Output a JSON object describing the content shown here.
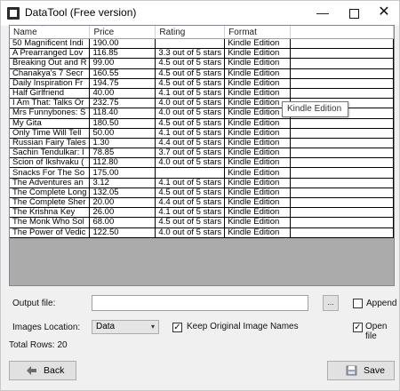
{
  "window": {
    "title": "DataTool (Free version)",
    "controls": {
      "minimize": "—",
      "close": "✕"
    }
  },
  "grid": {
    "columns": [
      "Name",
      "Price",
      "Rating",
      "Format"
    ],
    "sort_indicator": "^",
    "rows": [
      [
        "50 Magnificent Indi",
        "190.00",
        "",
        "Kindle Edition"
      ],
      [
        "A Prearranged Lov",
        "116.85",
        "3.3 out of 5 stars",
        "Kindle Edition"
      ],
      [
        "Breaking Out and R",
        "99.00",
        "4.5 out of 5 stars",
        "Kindle Edition"
      ],
      [
        "Chanakya's 7 Secr",
        "160.55",
        "4.5 out of 5 stars",
        "Kindle Edition"
      ],
      [
        "Daily Inspiration Fr",
        "194.75",
        "4.5 out of 5 stars",
        "Kindle Edition"
      ],
      [
        "Half Girlfriend",
        "40.00",
        "4.1 out of 5 stars",
        "Kindle Edition"
      ],
      [
        "I Am That: Talks Or",
        "232.75",
        "4.0 out of 5 stars",
        "Kindle Edition"
      ],
      [
        "Mrs Funnybones: S",
        "118.40",
        "4.0 out of 5 stars",
        "Kindle Edition"
      ],
      [
        "My Gita",
        "180.50",
        "4.5 out of 5 stars",
        "Kindle Edition"
      ],
      [
        "Only Time Will Tell",
        "50.00",
        "4.1 out of 5 stars",
        "Kindle Edition"
      ],
      [
        "Russian Fairy Tales",
        "1.30",
        "4.4 out of 5 stars",
        "Kindle Edition"
      ],
      [
        "Sachin Tendulkar: I",
        "78.85",
        "3.7 out of 5 stars",
        "Kindle Edition"
      ],
      [
        "Scion of Ikshvaku (",
        "112.80",
        "4.0 out of 5 stars",
        "Kindle Edition"
      ],
      [
        "Snacks For The So",
        "175.00",
        "",
        "Kindle Edition"
      ],
      [
        "The Adventures an",
        "3.12",
        "4.1 out of 5 stars",
        "Kindle Edition"
      ],
      [
        "The Complete Long",
        "132.05",
        "4.5 out of 5 stars",
        "Kindle Edition"
      ],
      [
        "The Complete Sher",
        "20.00",
        "4.4 out of 5 stars",
        "Kindle Edition"
      ],
      [
        "The Krishna Key",
        "26.00",
        "4.1 out of 5 stars",
        "Kindle Edition"
      ],
      [
        "The Monk Who Sol",
        "68.00",
        "4.5 out of 5 stars",
        "Kindle Edition"
      ],
      [
        "The Power of Vedic",
        "122.50",
        "4.0 out of 5 stars",
        "Kindle Edition"
      ]
    ]
  },
  "tooltip": "Kindle Edition",
  "form": {
    "output_file_label": "Output file:",
    "output_file_value": "",
    "browse_label": "...",
    "append_label": "Append",
    "append_checked": "",
    "images_location_label": "Images Location:",
    "images_location_value": "Data",
    "select_arrow": "▾",
    "keep_names_label": "Keep Original Image Names",
    "keep_names_checked": "✓",
    "open_file_label": "Open file",
    "open_file_checked": "✓",
    "total_rows_label": "Total Rows: 20"
  },
  "buttons": {
    "back": "Back",
    "save": "Save"
  },
  "colors": {
    "grid_border": "#828790",
    "grid_empty": "#ababab",
    "button_face": "#e1e1e1"
  }
}
